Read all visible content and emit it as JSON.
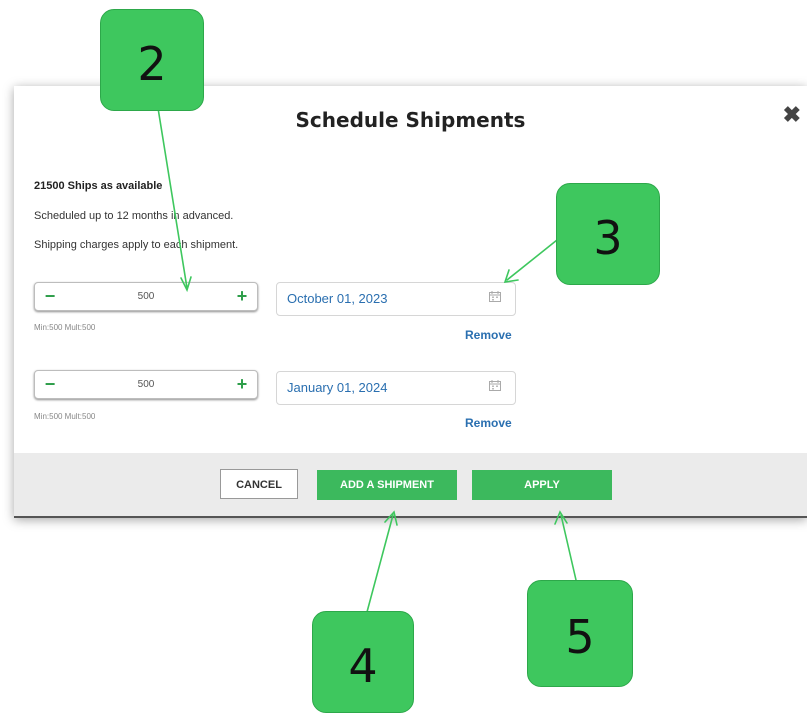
{
  "dialog": {
    "title": "Schedule Shipments",
    "close_glyph": "✖",
    "availability": "21500 Ships as available",
    "advance_note": "Scheduled up to 12 months in advanced.",
    "charges_note": "Shipping charges apply to each shipment."
  },
  "shipments": [
    {
      "quantity": "500",
      "minus": "−",
      "plus": "+",
      "min_mult": "Min:500  Mult:500",
      "date": "October 01, 2023",
      "remove_label": "Remove"
    },
    {
      "quantity": "500",
      "minus": "−",
      "plus": "+",
      "min_mult": "Min:500  Mult:500",
      "date": "January 01, 2024",
      "remove_label": "Remove"
    }
  ],
  "footer": {
    "cancel_label": "CANCEL",
    "add_label": "ADD A SHIPMENT",
    "apply_label": "APPLY"
  },
  "callouts": [
    "2",
    "3",
    "4",
    "5"
  ],
  "colors": {
    "accent_green": "#3cb95d",
    "link_blue": "#2a6fb0",
    "callout_green": "#3ec75e"
  },
  "icons": {
    "close": "close-icon",
    "calendar": "calendar-icon",
    "minus": "minus-icon",
    "plus": "plus-icon"
  }
}
